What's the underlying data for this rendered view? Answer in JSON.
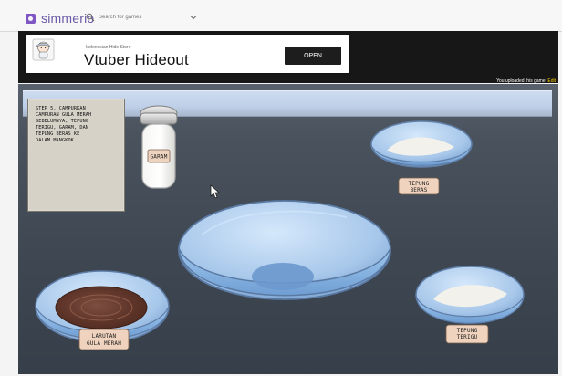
{
  "topbar": {
    "logo_text": "simmerio",
    "search_placeholder": "Search for games"
  },
  "ad": {
    "subtitle": "Indonesian Hide Store",
    "title": "Vtuber Hideout",
    "open_label": "OPEN"
  },
  "game": {
    "upload_note_prefix": "You uploaded this game! ",
    "upload_note_link": "Edit",
    "instruction_lines": [
      "STEP 5.  CAMPURKAN",
      "CAMPURAN GULA MERAH",
      "SEBELUMNYA, TEPUNG",
      "TERIGU, GARAM, DAN",
      "TEPUNG BERAS KE",
      "DALAM MANGKOK"
    ],
    "salt_label": "GARAM",
    "rice_flour_label_line1": "TEPUNG",
    "rice_flour_label_line2": "BERAS",
    "syrup_label_line1": "LARUTAN",
    "syrup_label_line2": "GULA MERAH",
    "wheat_flour_label_line1": "TEPUNG",
    "wheat_flour_label_line2": "TERIGU"
  },
  "icons": {
    "logo": "simmer-logo-icon",
    "search": "search-icon",
    "dropdown": "chevron-down-icon",
    "ad": "anime-avatar-icon",
    "cursor": "mouse-cursor-icon"
  }
}
